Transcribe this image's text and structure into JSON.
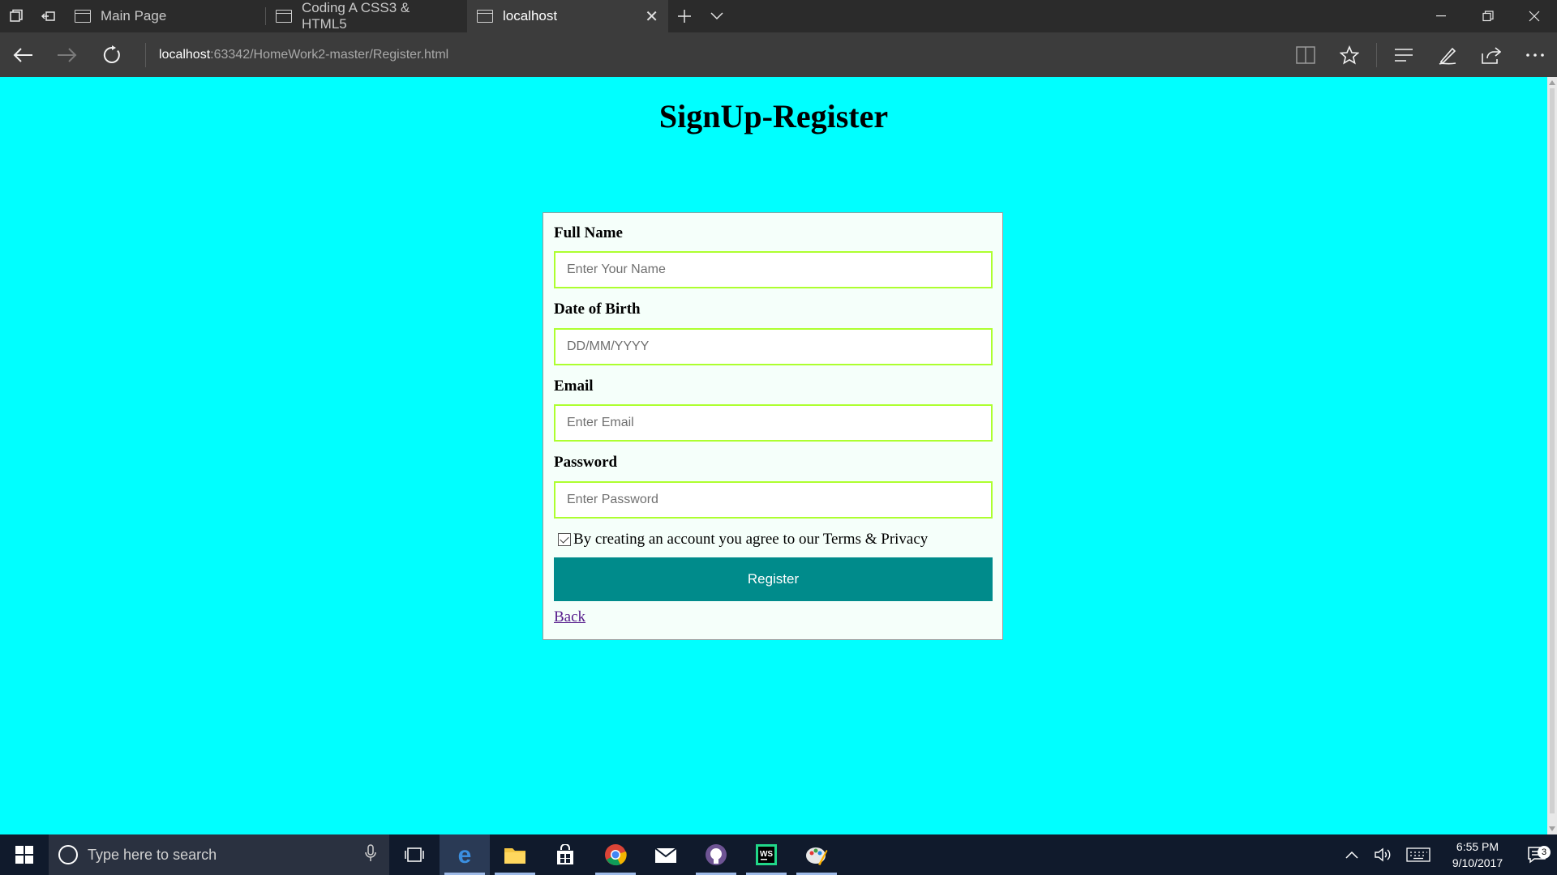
{
  "browser": {
    "tabs": [
      {
        "label": "Main Page"
      },
      {
        "label": "Coding A CSS3 & HTML5"
      },
      {
        "label": "localhost"
      }
    ],
    "address": {
      "host": "localhost",
      "rest": ":63342/HomeWork2-master/Register.html"
    }
  },
  "page": {
    "title": "SignUp-Register",
    "form": {
      "full_name_label": "Full Name",
      "full_name_placeholder": "Enter Your Name",
      "dob_label": "Date of Birth",
      "dob_placeholder": "DD/MM/YYYY",
      "email_label": "Email",
      "email_placeholder": "Enter Email",
      "password_label": "Password",
      "password_placeholder": "Enter Password",
      "agree_text": "By creating an account you agree to our Terms & Privacy",
      "agree_checked": true,
      "register_label": "Register",
      "back_label": "Back"
    },
    "colors": {
      "background": "#00ffff",
      "form_background": "#f5fffa",
      "input_border": "#adff2f",
      "button": "#008b8b"
    }
  },
  "taskbar": {
    "search_placeholder": "Type here to search",
    "apps": [
      "edge-icon",
      "file-explorer-icon",
      "store-icon",
      "chrome-icon",
      "mail-icon",
      "github-icon",
      "webstorm-icon",
      "paint-icon"
    ],
    "time": "6:55 PM",
    "date": "9/10/2017",
    "notification_count": "3"
  }
}
